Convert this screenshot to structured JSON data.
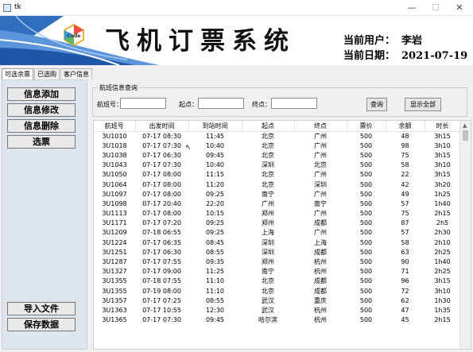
{
  "window": {
    "title": "tk",
    "minimize": "—",
    "maximize": "☐",
    "close": "✕"
  },
  "banner": {
    "logo_text": "Code",
    "heading": "飞机订票系统",
    "user_label": "当前用户：",
    "user_name": "李岩",
    "date_label": "当前日期：",
    "date_value": "2021-07-19"
  },
  "tabs": [
    {
      "label": "可选余票",
      "active": true
    },
    {
      "label": "已选购",
      "active": false
    },
    {
      "label": "客户信息",
      "active": false
    }
  ],
  "sidebar": {
    "buttons": [
      "信息添加",
      "信息修改",
      "信息删除",
      "选票"
    ],
    "bottom_buttons": [
      "导入文件",
      "保存数据"
    ]
  },
  "query": {
    "frame_label": "航班信息查询",
    "flight_label": "航班号：",
    "from_label": "起点：",
    "to_label": "终点：",
    "flight_value": "",
    "from_value": "",
    "to_value": "",
    "search_button": "查询",
    "show_all_button": "显示全部"
  },
  "table": {
    "columns": [
      "航班号",
      "出发时间",
      "到站时间",
      "起点",
      "终点",
      "票价",
      "余额",
      "时长"
    ],
    "rows": [
      [
        "3U1010",
        "07-17 08:30",
        "11:45",
        "北京",
        "广州",
        "500",
        "48",
        "3h15"
      ],
      [
        "3U1018",
        "07-17 07:30",
        "10:40",
        "北京",
        "广州",
        "500",
        "98",
        "3h10"
      ],
      [
        "3U1038",
        "07-17 06:30",
        "09:45",
        "北京",
        "广州",
        "500",
        "75",
        "3h15"
      ],
      [
        "3U1043",
        "07-17 07:30",
        "10:40",
        "深圳",
        "北京",
        "500",
        "58",
        "3h10"
      ],
      [
        "3U1050",
        "07-17 08:00",
        "11:15",
        "北京",
        "广州",
        "500",
        "22",
        "3h15"
      ],
      [
        "3U1064",
        "07-17 08:00",
        "11:20",
        "北京",
        "深圳",
        "500",
        "42",
        "3h20"
      ],
      [
        "3U1097",
        "07-17 08:00",
        "09:25",
        "南宁",
        "广州",
        "500",
        "49",
        "1h25"
      ],
      [
        "3U1098",
        "07-17 20:40",
        "22:20",
        "广州",
        "南宁",
        "500",
        "57",
        "1h40"
      ],
      [
        "3U1113",
        "07-17 08:00",
        "10:15",
        "郑州",
        "广州",
        "500",
        "75",
        "2h15"
      ],
      [
        "3U1171",
        "07-17 07:20",
        "09:25",
        "郑州",
        "成都",
        "500",
        "87",
        "2h5"
      ],
      [
        "3U1209",
        "07-18 06:55",
        "09:25",
        "上海",
        "广州",
        "500",
        "57",
        "2h30"
      ],
      [
        "3U1224",
        "07-17 06:35",
        "08:45",
        "深圳",
        "上海",
        "500",
        "58",
        "2h10"
      ],
      [
        "3U1251",
        "07-17 06:30",
        "08:55",
        "深圳",
        "成都",
        "500",
        "63",
        "2h25"
      ],
      [
        "3U1287",
        "07-17 07:55",
        "09:35",
        "郑州",
        "杭州",
        "500",
        "90",
        "1h40"
      ],
      [
        "3U1327",
        "07-17 09:00",
        "11:25",
        "南宁",
        "杭州",
        "500",
        "71",
        "2h25"
      ],
      [
        "3U1355",
        "07-18 07:55",
        "11:10",
        "北京",
        "成都",
        "500",
        "96",
        "3h15"
      ],
      [
        "3U1355",
        "07-19 08:00",
        "11:10",
        "北京",
        "成都",
        "500",
        "72",
        "3h10"
      ],
      [
        "3U1357",
        "07-17 07:25",
        "08:55",
        "武汉",
        "重庆",
        "500",
        "62",
        "1h30"
      ],
      [
        "3U1363",
        "07-17 10:55",
        "12:30",
        "武汉",
        "杭州",
        "500",
        "47",
        "1h35"
      ],
      [
        "3U1365",
        "07-17 07:30",
        "09:45",
        "哈尔滨",
        "杭州",
        "500",
        "45",
        "2h15"
      ]
    ]
  }
}
